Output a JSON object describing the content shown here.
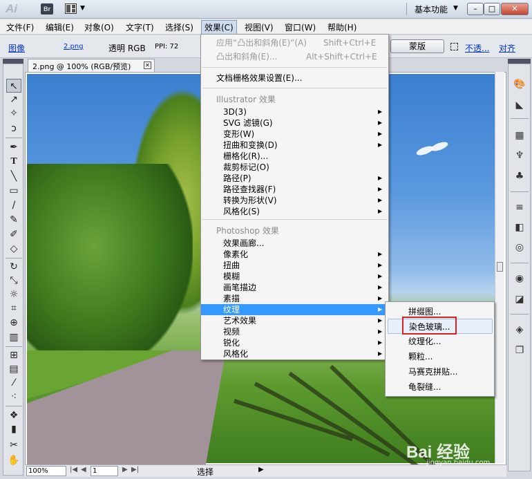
{
  "titlebar": {
    "app_logo": "Ai",
    "bridge_label": "Br",
    "workspace": "基本功能",
    "min_label": "–",
    "max_label": "□",
    "close_label": "✕"
  },
  "menubar": {
    "items": [
      {
        "label": "文件(F)"
      },
      {
        "label": "编辑(E)"
      },
      {
        "label": "对象(O)"
      },
      {
        "label": "文字(T)"
      },
      {
        "label": "选择(S)"
      },
      {
        "label": "效果(C)"
      },
      {
        "label": "视图(V)"
      },
      {
        "label": "窗口(W)"
      },
      {
        "label": "帮助(H)"
      }
    ]
  },
  "controlbar": {
    "type_label": "图像",
    "filename": "2.png",
    "color_mode": "透明 RGB",
    "ppi": "PPI: 72",
    "mask_button": "蒙版",
    "opacity_link": "不透...",
    "align_link": "对齐"
  },
  "document": {
    "tab_title": "2.png @ 100% (RGB/预览)",
    "tab_close": "✕"
  },
  "statusbar": {
    "zoom": "100%",
    "page": "1",
    "tool_status": "选择"
  },
  "effect_menu": {
    "apply_last": "应用“凸出和斜角(E)”(A)",
    "apply_last_shortcut": "Shift+Ctrl+E",
    "last_effect": "凸出和斜角(E)...",
    "last_effect_shortcut": "Alt+Shift+Ctrl+E",
    "raster_settings": "文档栅格效果设置(E)...",
    "illustrator_header": "Illustrator 效果",
    "illustrator_items": [
      {
        "label": "3D(3)",
        "submenu": true
      },
      {
        "label": "SVG 滤镜(G)",
        "submenu": true
      },
      {
        "label": "变形(W)",
        "submenu": true
      },
      {
        "label": "扭曲和变换(D)",
        "submenu": true
      },
      {
        "label": "栅格化(R)...",
        "submenu": false
      },
      {
        "label": "裁剪标记(O)",
        "submenu": false
      },
      {
        "label": "路径(P)",
        "submenu": true
      },
      {
        "label": "路径查找器(F)",
        "submenu": true
      },
      {
        "label": "转换为形状(V)",
        "submenu": true
      },
      {
        "label": "风格化(S)",
        "submenu": true
      }
    ],
    "photoshop_header": "Photoshop 效果",
    "photoshop_items": [
      {
        "label": "效果画廊...",
        "submenu": false
      },
      {
        "label": "像素化",
        "submenu": true
      },
      {
        "label": "扭曲",
        "submenu": true
      },
      {
        "label": "模糊",
        "submenu": true
      },
      {
        "label": "画笔描边",
        "submenu": true
      },
      {
        "label": "素描",
        "submenu": true
      },
      {
        "label": "纹理",
        "submenu": true
      },
      {
        "label": "艺术效果",
        "submenu": true
      },
      {
        "label": "视频",
        "submenu": true
      },
      {
        "label": "锐化",
        "submenu": true
      },
      {
        "label": "风格化",
        "submenu": true
      }
    ],
    "highlighted": "纹理"
  },
  "texture_submenu": {
    "items": [
      {
        "label": "拼缀图..."
      },
      {
        "label": "染色玻璃..."
      },
      {
        "label": "纹理化..."
      },
      {
        "label": "颗粒..."
      },
      {
        "label": "马赛克拼贴..."
      },
      {
        "label": "龟裂缝..."
      }
    ],
    "hovered": "染色玻璃..."
  },
  "watermark": {
    "brand": "Bai  经验",
    "url": "jingyan.baidu.com"
  },
  "colors": {
    "menu_highlight": "#3399ff",
    "annotation_box": "#e02020"
  }
}
